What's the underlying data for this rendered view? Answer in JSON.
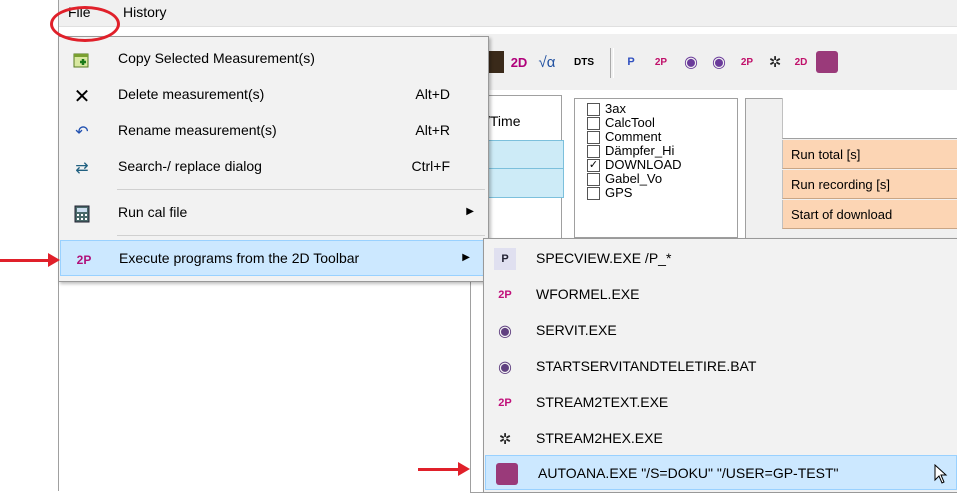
{
  "menubar": {
    "file": "File",
    "history": "History"
  },
  "file_menu": {
    "items": [
      {
        "label": "Copy Selected Measurement(s)",
        "shortcut": "",
        "icon": "copy-plus-icon"
      },
      {
        "label": "Delete measurement(s)",
        "shortcut": "Alt+D",
        "icon": "delete-x-icon"
      },
      {
        "label": "Rename measurement(s)",
        "shortcut": "Alt+R",
        "icon": "rename-undo-icon"
      },
      {
        "label": "Search-/ replace dialog",
        "shortcut": "Ctrl+F",
        "icon": "search-replace-icon"
      },
      {
        "label": "Run cal file",
        "shortcut": "",
        "icon": "calculator-icon"
      },
      {
        "label": "Execute programs from the 2D Toolbar",
        "shortcut": "",
        "icon": "2d-toolbar-icon"
      }
    ]
  },
  "submenu": {
    "items": [
      {
        "label": "SPECVIEW.EXE /P_*",
        "icon": "specview-p-icon"
      },
      {
        "label": "WFORMEL.EXE",
        "icon": "wformel-2d-icon"
      },
      {
        "label": "SERVIT.EXE",
        "icon": "servit-icon"
      },
      {
        "label": "STARTSERVITANDTELETIRE.BAT",
        "icon": "servit-teletire-icon"
      },
      {
        "label": "STREAM2TEXT.EXE",
        "icon": "stream2text-icon"
      },
      {
        "label": "STREAM2HEX.EXE",
        "icon": "stream2hex-icon"
      },
      {
        "label": "AUTOANA.EXE \"/S=DOKU\" \"/USER=GP-TEST\"",
        "icon": "autoana-avatar-icon"
      }
    ]
  },
  "toolbar": {
    "dts_label": "DTS",
    "sqrt_label": "√α",
    "p_label": "P",
    "twod_label": "2D"
  },
  "grid": {
    "time_header": "/Time"
  },
  "checklist": {
    "items": [
      {
        "label": "3ax",
        "checked": false
      },
      {
        "label": "CalcTool",
        "checked": false
      },
      {
        "label": "Comment",
        "checked": false
      },
      {
        "label": "Dämpfer_Hi",
        "checked": false
      },
      {
        "label": "DOWNLOAD",
        "checked": true
      },
      {
        "label": "Gabel_Vo",
        "checked": false
      },
      {
        "label": "GPS",
        "checked": false
      }
    ]
  },
  "info_panel": {
    "rows": [
      "Run total [s]",
      "Run recording [s]",
      "Start of download"
    ]
  },
  "colors": {
    "highlight": "#cce8ff",
    "annotation_red": "#e0202a",
    "info_orange": "#fcd5b4",
    "cell_blue": "#cdebf7"
  }
}
